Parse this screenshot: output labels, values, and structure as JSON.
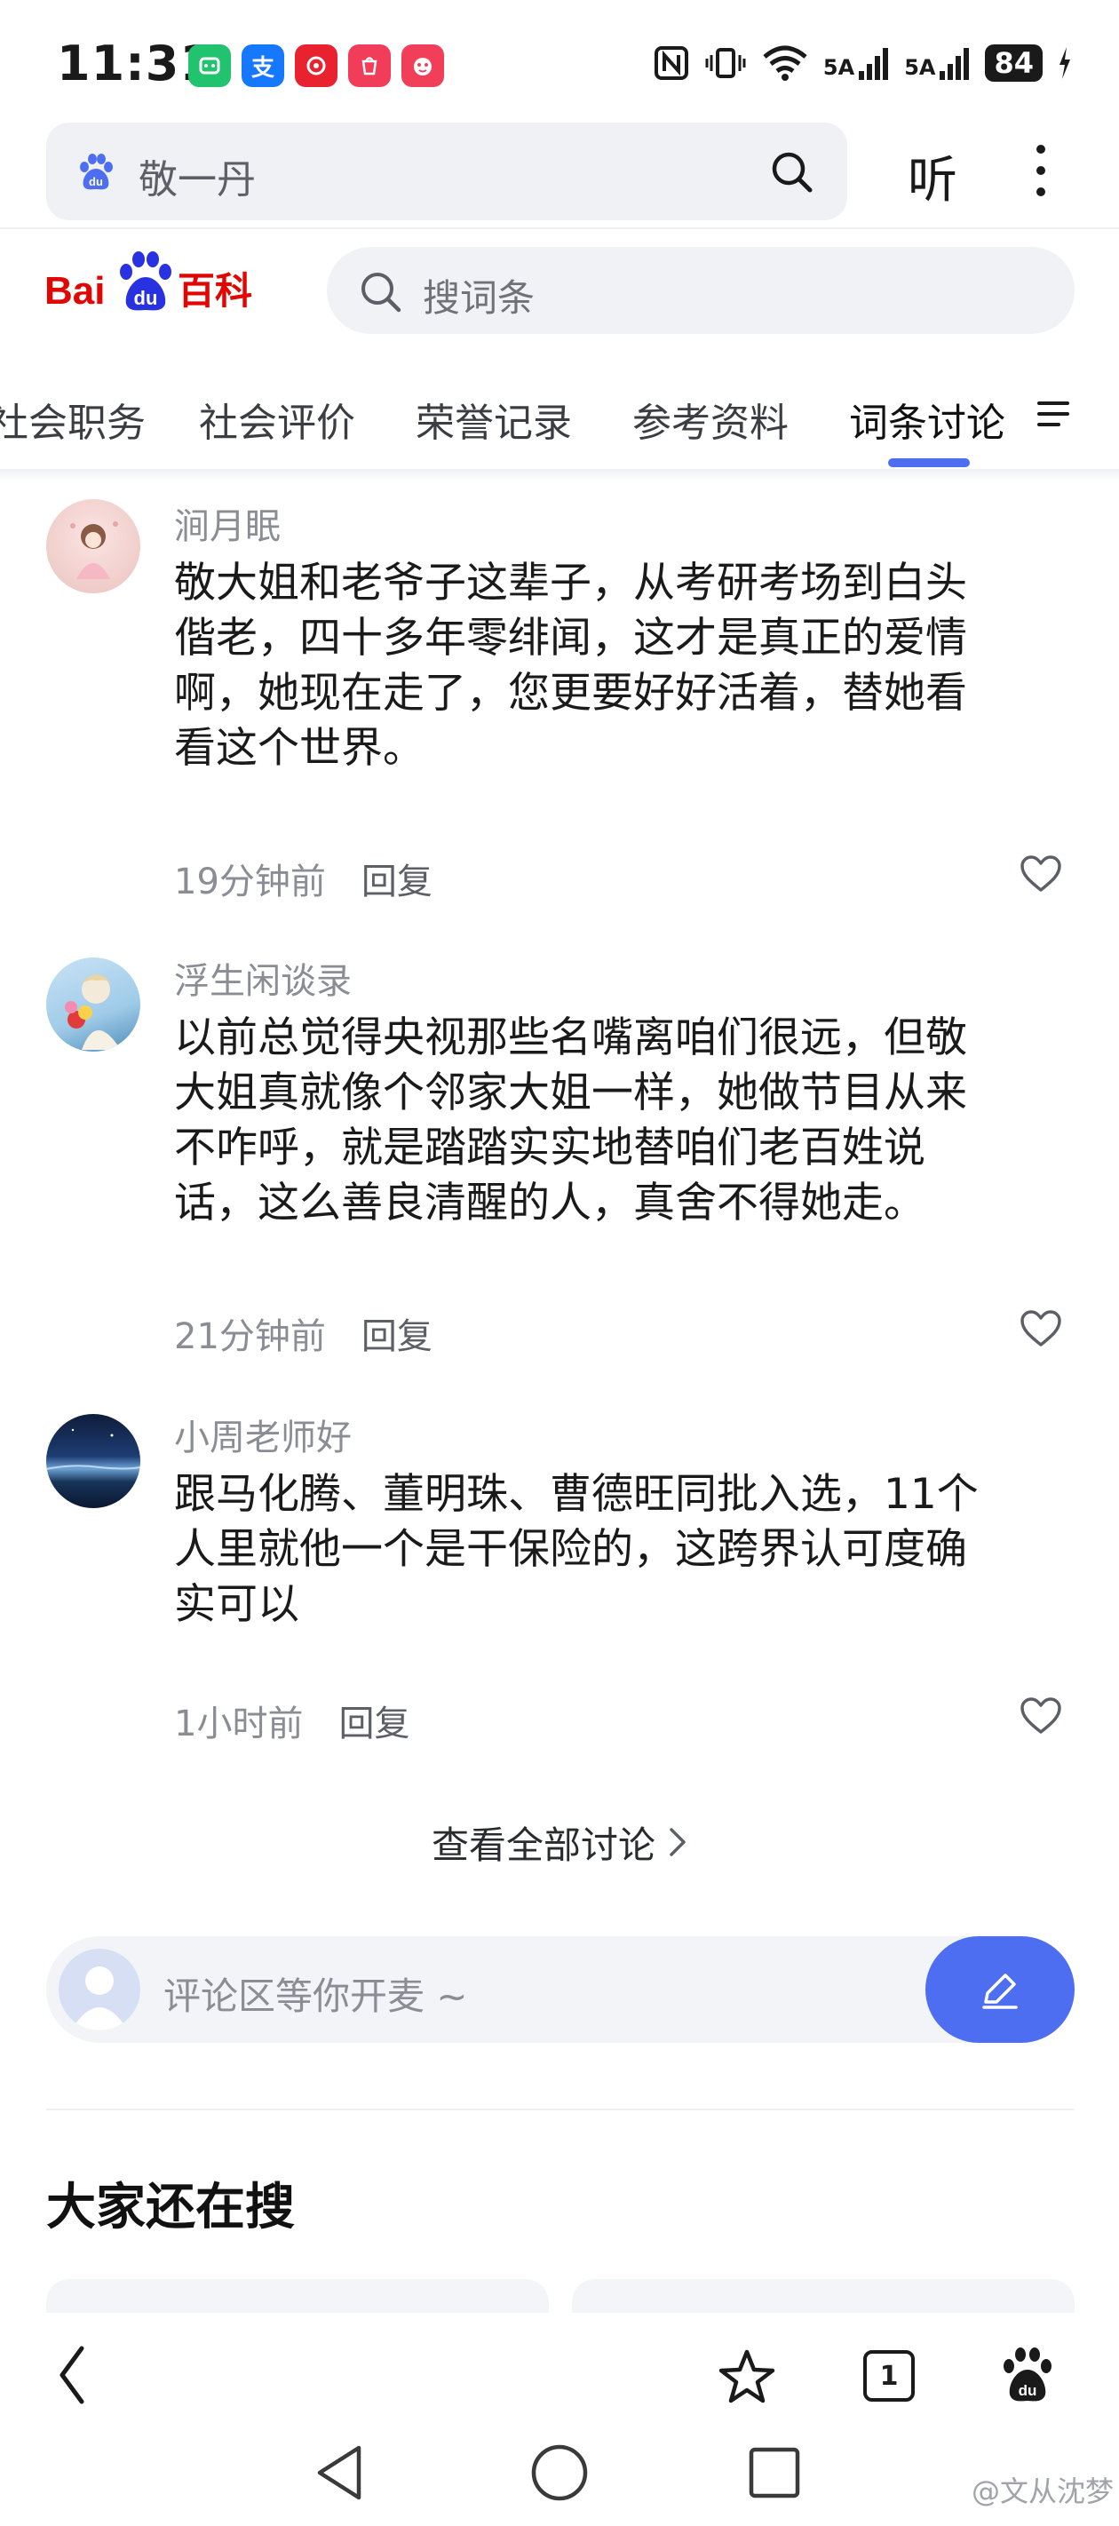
{
  "status_bar": {
    "time": "11:31",
    "app_icons": [
      "wechat-mini-icon",
      "alipay-icon",
      "netease-icon",
      "app-gallery-icon",
      "taobao-icon"
    ],
    "alipay_char": "支",
    "network_1": "5A",
    "network_2": "5A",
    "battery": "84"
  },
  "browser": {
    "query": "敬一丹",
    "listen_label": "听"
  },
  "baike": {
    "logo_text": "Bai du 百科",
    "search_placeholder": "搜词条"
  },
  "tabs": {
    "items": [
      {
        "label": "社会职务"
      },
      {
        "label": "社会评价"
      },
      {
        "label": "荣誉记录"
      },
      {
        "label": "参考资料"
      },
      {
        "label": "词条讨论"
      }
    ],
    "active_index": 4
  },
  "comments": [
    {
      "user": "涧月眠",
      "lines": [
        "敬大姐和老爷子这辈子，从考研考场到白头",
        "偕老，四十多年零绯闻，这才是真正的爱情",
        "啊，她现在走了，您更要好好活着，替她看",
        "看这个世界。"
      ],
      "time": "19分钟前",
      "reply": "回复"
    },
    {
      "user": "浮生闲谈录",
      "lines": [
        "以前总觉得央视那些名嘴离咱们很远，但敬",
        "大姐真就像个邻家大姐一样，她做节目从来",
        "不咋呼，就是踏踏实实地替咱们老百姓说",
        "话，这么善良清醒的人，真舍不得她走。"
      ],
      "time": "21分钟前",
      "reply": "回复"
    },
    {
      "user": "小周老师好",
      "lines": [
        "跟马化腾、董明珠、曹德旺同批入选，11个",
        "人里就他一个是干保险的，这跨界认可度确",
        "实可以"
      ],
      "time": "1小时前",
      "reply": "回复"
    }
  ],
  "view_all": "查看全部讨论",
  "comment_input": {
    "placeholder": "评论区等你开麦 ~"
  },
  "section": {
    "title": "大家还在搜"
  },
  "bottom_nav": {
    "tab_count": "1"
  },
  "watermark": "@文从沈梦",
  "colors": {
    "accent": "#4e6ef2",
    "baidu_red": "#e10602",
    "baidu_blue": "#2932e1"
  }
}
